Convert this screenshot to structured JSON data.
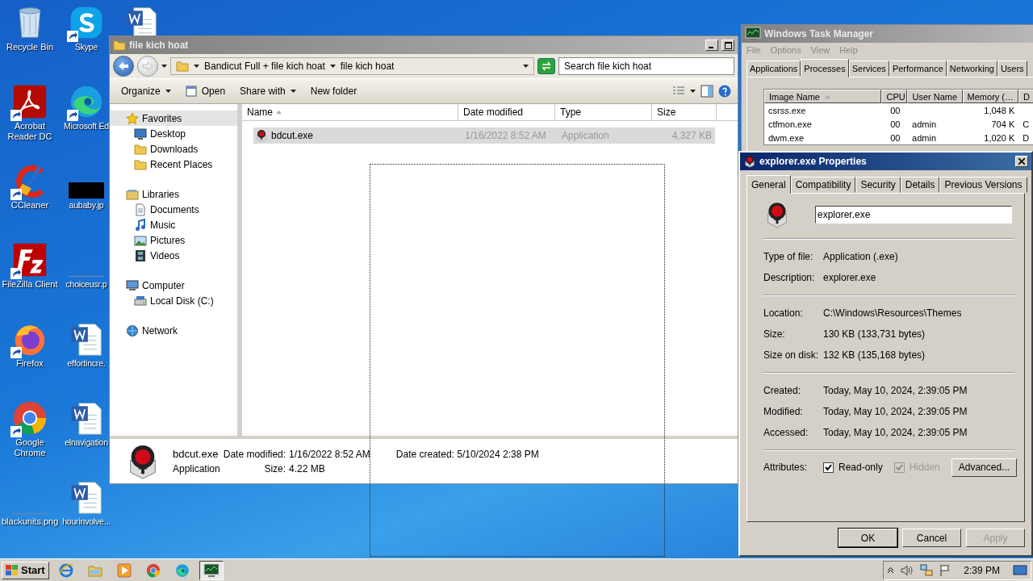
{
  "desktop": {
    "icons": [
      {
        "label": "Recycle Bin",
        "kind": "recycle",
        "shortcut": false
      },
      {
        "label": "Acrobat Reader DC",
        "kind": "acrobat",
        "shortcut": true
      },
      {
        "label": "CCleaner",
        "kind": "ccleaner",
        "shortcut": true
      },
      {
        "label": "FileZilla Client",
        "kind": "filezilla",
        "shortcut": true
      },
      {
        "label": "Firefox",
        "kind": "firefox",
        "shortcut": true
      },
      {
        "label": "Google Chrome",
        "kind": "chrome",
        "shortcut": true
      },
      {
        "label": "blackunits.png",
        "kind": "blank-image",
        "shortcut": false
      },
      {
        "label": "Skype",
        "kind": "skype",
        "shortcut": true
      },
      {
        "label": "Microsoft Ed",
        "kind": "edge",
        "shortcut": true
      },
      {
        "label": "aubaby.jp",
        "kind": "black-image",
        "shortcut": false
      },
      {
        "label": "choiceusr.p",
        "kind": "blank-image",
        "shortcut": false
      },
      {
        "label": "effortincre.",
        "kind": "word",
        "shortcut": false
      },
      {
        "label": "elnavigation",
        "kind": "word",
        "shortcut": false
      },
      {
        "label": "hourinvolve...",
        "kind": "word",
        "shortcut": false
      },
      {
        "kind": "word",
        "shortcut": false
      }
    ]
  },
  "explorer": {
    "title": "file kich hoat",
    "active": false,
    "breadcrumbs": [
      "Bandicut Full + file kich hoat",
      "file kich hoat"
    ],
    "search": {
      "placeholder": "Search file kich hoat"
    },
    "toolbar": [
      {
        "label": "Organize",
        "kind": "menu"
      },
      {
        "label": "Open",
        "kind": "open"
      },
      {
        "label": "Share with",
        "kind": "menu"
      },
      {
        "label": "New folder",
        "kind": "plain"
      }
    ],
    "nav": [
      {
        "label": "Favorites",
        "kind": "star",
        "selected": true,
        "children": [
          {
            "label": "Desktop",
            "kind": "desktop",
            "selected": false
          },
          {
            "label": "Downloads",
            "kind": "folder",
            "selected": false
          },
          {
            "label": "Recent Places",
            "kind": "folder",
            "selected": false
          }
        ]
      },
      {
        "label": "Libraries",
        "kind": "library",
        "selected": false,
        "children": [
          {
            "label": "Documents",
            "kind": "document",
            "selected": false
          },
          {
            "label": "Music",
            "kind": "music",
            "selected": false
          },
          {
            "label": "Pictures",
            "kind": "picture",
            "selected": false
          },
          {
            "label": "Videos",
            "kind": "film",
            "selected": false
          }
        ]
      },
      {
        "label": "Computer",
        "kind": "computer",
        "selected": false,
        "children": [
          {
            "label": "Local Disk (C:)",
            "kind": "disk",
            "selected": false
          }
        ]
      },
      {
        "label": "Network",
        "kind": "network",
        "selected": false
      }
    ],
    "columns": [
      "Name",
      "Date modified",
      "Type",
      "Size"
    ],
    "rows": [
      {
        "cells": [
          "bdcut.exe",
          "1/16/2022 8:52 AM",
          "Application",
          "4,327 KB"
        ],
        "selected": true
      }
    ],
    "details": {
      "name": "bdcut.exe",
      "type": "Application",
      "fields": [
        {
          "label": "Date modified:",
          "value": "1/16/2022 8:52 AM"
        },
        {
          "label": "Size:",
          "value": "4.22 MB"
        },
        {
          "label": "Date created:",
          "value": "5/10/2024 2:38 PM"
        }
      ]
    }
  },
  "task_manager": {
    "title": "Windows Task Manager",
    "active": false,
    "menu": [
      "File",
      "Options",
      "View",
      "Help"
    ],
    "tabs": [
      {
        "label": "Applications",
        "selected": false
      },
      {
        "label": "Processes",
        "selected": true
      },
      {
        "label": "Services",
        "selected": false
      },
      {
        "label": "Performance",
        "selected": false
      },
      {
        "label": "Networking",
        "selected": false
      },
      {
        "label": "Users",
        "selected": false
      }
    ],
    "columns": [
      "Image Name",
      "CPU",
      "User Name",
      "Memory (…",
      "D"
    ],
    "rows": [
      {
        "cells": [
          "csrss.exe",
          "00",
          "",
          "1,048 K",
          ""
        ]
      },
      {
        "cells": [
          "ctfmon.exe",
          "00",
          "admin",
          "704 K",
          "C"
        ]
      },
      {
        "cells": [
          "dwm.exe",
          "00",
          "admin",
          "1,020 K",
          "D"
        ]
      }
    ]
  },
  "properties": {
    "title": "explorer.exe Properties",
    "active": true,
    "tabs": [
      {
        "label": "General",
        "selected": true
      },
      {
        "label": "Compatibility",
        "selected": false
      },
      {
        "label": "Security",
        "selected": false
      },
      {
        "label": "Details",
        "selected": false
      },
      {
        "label": "Previous Versions",
        "selected": false
      }
    ],
    "name": "explorer.exe",
    "sections": [
      [
        {
          "label": "Type of file:",
          "value": "Application (.exe)"
        },
        {
          "label": "Description:",
          "value": "explorer.exe"
        }
      ],
      [
        {
          "label": "Location:",
          "value": "C:\\Windows\\Resources\\Themes"
        },
        {
          "label": "Size:",
          "value": "130 KB (133,731 bytes)"
        },
        {
          "label": "Size on disk:",
          "value": "132 KB (135,168 bytes)"
        }
      ],
      [
        {
          "label": "Created:",
          "value": "Today, May 10, 2024, 2:39:05 PM"
        },
        {
          "label": "Modified:",
          "value": "Today, May 10, 2024, 2:39:05 PM"
        },
        {
          "label": "Accessed:",
          "value": "Today, May 10, 2024, 2:39:05 PM"
        }
      ]
    ],
    "attributes_label": "Attributes:",
    "attributes": [
      {
        "label": "Read-only",
        "checked": true,
        "disabled": false
      },
      {
        "label": "Hidden",
        "checked": true,
        "disabled": true
      }
    ],
    "advanced": "Advanced...",
    "buttons": [
      {
        "label": "OK",
        "default": true,
        "disabled": false
      },
      {
        "label": "Cancel",
        "default": false,
        "disabled": false
      },
      {
        "label": "Apply",
        "default": false,
        "disabled": true
      }
    ]
  },
  "taskbar": {
    "start": "Start",
    "items": [
      {
        "kind": "ie",
        "selected": false
      },
      {
        "kind": "folder",
        "selected": false
      },
      {
        "kind": "media",
        "selected": false
      },
      {
        "kind": "chrome",
        "selected": false
      },
      {
        "kind": "edge",
        "selected": false
      },
      {
        "kind": "taskmgr",
        "selected": true
      }
    ],
    "clock": "2:39 PM"
  }
}
